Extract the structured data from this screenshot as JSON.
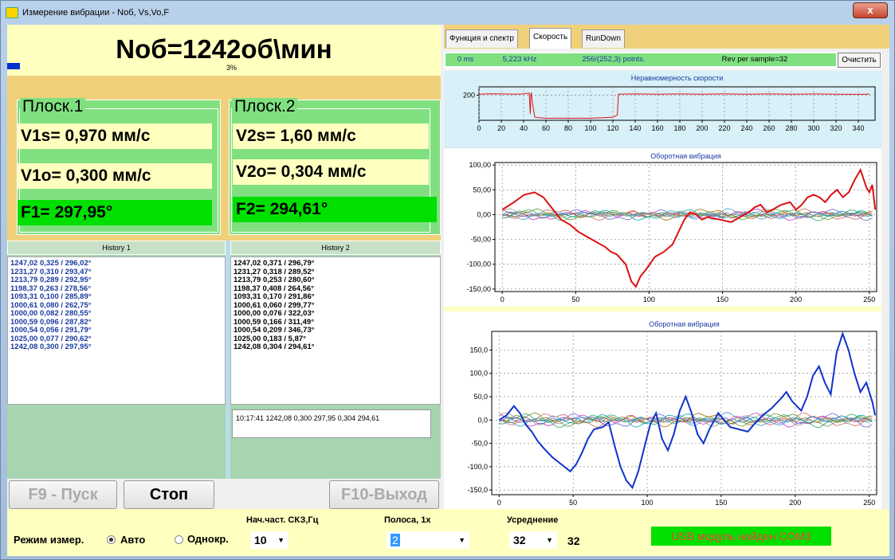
{
  "window": {
    "title": "Измерение вибрации - Nоб, Vs,Vo,F",
    "close_label": "x"
  },
  "speed": {
    "text": "Nоб=1242об\\мин",
    "progress_label": "3%",
    "progress_fraction": 0.03
  },
  "plane1": {
    "title": "Плоск.1",
    "vs": "V1s= 0,970 мм/с",
    "vo": "V1o= 0,300 мм/с",
    "f": "F1= 297,95°"
  },
  "plane2": {
    "title": "Плоск.2",
    "vs": "V2s= 1,60 мм/с",
    "vo": "V2o= 0,304 мм/с",
    "f": "F2= 294,61°"
  },
  "history1": {
    "title": "History 1",
    "rows": [
      "1247,02 0,325 / 296,02°",
      "1231,27 0,310 / 293,47°",
      "1213,79 0,289 / 292,95°",
      "1198,37 0,263 / 278,56°",
      "1093,31 0,100 / 285,89°",
      "1000,61 0,080 / 262,75°",
      "1000,00 0,082 / 280,55°",
      "1000,59 0,096 / 287,82°",
      "1000,54 0,056 / 291,79°",
      "1025,00 0,077 / 290,62°",
      "1242,08 0,300 / 297,95°"
    ]
  },
  "history2": {
    "title": "History 2",
    "rows": [
      "1247,02 0,371 / 296,79°",
      "1231,27 0,318 / 289,52°",
      "1213,79 0,253 / 280,60°",
      "1198,37 0,408 / 264,56°",
      "1093,31 0,170 / 291,86°",
      "1000,61 0,060 / 299,77°",
      "1000,00 0,076 / 322,03°",
      "1000,59 0,166 / 311,49°",
      "1000,54 0,209 / 346,73°",
      "1025,00 0,183 / 5,87°",
      "1242,08 0,304 / 294,61°"
    ]
  },
  "log": {
    "text": "10:17:41 1242,08 0,300 297,95 0,304 294,61"
  },
  "buttons": {
    "start": "F9 - Пуск",
    "stop": "Стоп",
    "exit": "F10-Выход"
  },
  "tabs": [
    "Функция и спектр",
    "Скорость",
    "RunDown"
  ],
  "active_tab": 1,
  "status": {
    "ms": "0 ms",
    "freq": "5,223 kHz",
    "points": "256/(252,3) points.",
    "rev": "Rev per sample=32",
    "clear": "Очистить"
  },
  "colors": {
    "panel_green": "#80e080",
    "value_yellow": "#ffffc0",
    "phase_green": "#00e000",
    "accent_red": "#dd1111",
    "accent_blue": "#1133cc"
  },
  "chart_data": [
    {
      "type": "line",
      "title": "Неравномерность скорости",
      "x_ticks": [
        "0",
        "20",
        "40",
        "60",
        "80",
        "100",
        "120",
        "140",
        "160",
        "180",
        "200",
        "220",
        "240",
        "260",
        "280",
        "300",
        "320",
        "340"
      ],
      "y_ticks": [
        "200"
      ],
      "xlim": [
        0,
        355
      ],
      "ylim": [
        80,
        240
      ],
      "grid": true,
      "series": [
        {
          "color": "#dd1111",
          "points": [
            [
              0,
              205
            ],
            [
              10,
              207
            ],
            [
              20,
              206
            ],
            [
              30,
              205
            ],
            [
              40,
              206
            ],
            [
              45,
              210
            ],
            [
              46,
              110
            ],
            [
              46.5,
              205
            ],
            [
              47,
              210
            ],
            [
              48,
              160
            ],
            [
              50,
              95
            ],
            [
              55,
              92
            ],
            [
              60,
              90
            ],
            [
              70,
              90
            ],
            [
              80,
              90
            ],
            [
              90,
              90
            ],
            [
              100,
              90
            ],
            [
              110,
              92
            ],
            [
              120,
              95
            ],
            [
              124,
              105
            ],
            [
              125,
              205
            ],
            [
              140,
              206
            ],
            [
              160,
              205
            ],
            [
              180,
              206
            ],
            [
              200,
              205
            ],
            [
              220,
              206
            ],
            [
              240,
              205
            ],
            [
              260,
              206
            ],
            [
              280,
              205
            ],
            [
              300,
              206
            ],
            [
              320,
              205
            ],
            [
              340,
              204
            ],
            [
              350,
              205
            ]
          ]
        }
      ]
    },
    {
      "type": "line",
      "title": "Оборотная вибрация",
      "x_ticks": [
        "0",
        "50",
        "100",
        "150",
        "200",
        "250"
      ],
      "y_ticks": [
        "100,00",
        "50,00",
        "0,00",
        "-50,00",
        "-100,00",
        "-150,00"
      ],
      "xlim": [
        -5,
        255
      ],
      "ylim": [
        -155,
        105
      ],
      "grid": true,
      "series": [
        {
          "color": "#dd1111",
          "points": [
            [
              0,
              10
            ],
            [
              8,
              25
            ],
            [
              15,
              40
            ],
            [
              22,
              45
            ],
            [
              28,
              35
            ],
            [
              32,
              20
            ],
            [
              36,
              5
            ],
            [
              40,
              -10
            ],
            [
              46,
              -20
            ],
            [
              52,
              -35
            ],
            [
              58,
              -45
            ],
            [
              64,
              -55
            ],
            [
              70,
              -65
            ],
            [
              74,
              -75
            ],
            [
              78,
              -80
            ],
            [
              84,
              -100
            ],
            [
              88,
              -135
            ],
            [
              91,
              -145
            ],
            [
              94,
              -125
            ],
            [
              98,
              -110
            ],
            [
              104,
              -85
            ],
            [
              110,
              -75
            ],
            [
              116,
              -60
            ],
            [
              120,
              -35
            ],
            [
              124,
              -10
            ],
            [
              128,
              5
            ],
            [
              132,
              0
            ],
            [
              136,
              -10
            ],
            [
              140,
              -5
            ],
            [
              148,
              -10
            ],
            [
              156,
              -15
            ],
            [
              162,
              -5
            ],
            [
              168,
              5
            ],
            [
              172,
              15
            ],
            [
              176,
              20
            ],
            [
              180,
              5
            ],
            [
              184,
              10
            ],
            [
              190,
              20
            ],
            [
              196,
              25
            ],
            [
              200,
              10
            ],
            [
              204,
              20
            ],
            [
              208,
              35
            ],
            [
              212,
              40
            ],
            [
              216,
              35
            ],
            [
              220,
              25
            ],
            [
              224,
              40
            ],
            [
              228,
              50
            ],
            [
              232,
              35
            ],
            [
              236,
              45
            ],
            [
              240,
              70
            ],
            [
              244,
              90
            ],
            [
              248,
              55
            ],
            [
              250,
              45
            ],
            [
              252,
              60
            ],
            [
              254,
              10
            ]
          ]
        }
      ]
    },
    {
      "type": "line",
      "title": "Оборотная вибрация",
      "x_ticks": [
        "0",
        "50",
        "100",
        "150",
        "200",
        "250"
      ],
      "y_ticks": [
        "150,0",
        "100,0",
        "50,0",
        "0,0",
        "-50,0",
        "-100,0",
        "-150,0"
      ],
      "xlim": [
        -5,
        255
      ],
      "ylim": [
        -160,
        190
      ],
      "grid": true,
      "series": [
        {
          "color": "#1133cc",
          "points": [
            [
              0,
              0
            ],
            [
              5,
              10
            ],
            [
              10,
              30
            ],
            [
              14,
              15
            ],
            [
              18,
              -10
            ],
            [
              22,
              -25
            ],
            [
              26,
              -45
            ],
            [
              30,
              -60
            ],
            [
              36,
              -80
            ],
            [
              42,
              -95
            ],
            [
              48,
              -110
            ],
            [
              52,
              -95
            ],
            [
              56,
              -70
            ],
            [
              60,
              -40
            ],
            [
              64,
              -20
            ],
            [
              70,
              -15
            ],
            [
              74,
              -5
            ],
            [
              78,
              -55
            ],
            [
              82,
              -100
            ],
            [
              86,
              -130
            ],
            [
              90,
              -145
            ],
            [
              94,
              -110
            ],
            [
              98,
              -60
            ],
            [
              102,
              -10
            ],
            [
              106,
              15
            ],
            [
              110,
              -40
            ],
            [
              114,
              -65
            ],
            [
              118,
              -30
            ],
            [
              122,
              20
            ],
            [
              126,
              50
            ],
            [
              130,
              15
            ],
            [
              134,
              -30
            ],
            [
              138,
              -50
            ],
            [
              142,
              -20
            ],
            [
              148,
              15
            ],
            [
              152,
              0
            ],
            [
              156,
              -15
            ],
            [
              162,
              -20
            ],
            [
              168,
              -25
            ],
            [
              172,
              -10
            ],
            [
              178,
              10
            ],
            [
              184,
              25
            ],
            [
              190,
              45
            ],
            [
              194,
              60
            ],
            [
              198,
              40
            ],
            [
              204,
              20
            ],
            [
              208,
              50
            ],
            [
              212,
              95
            ],
            [
              216,
              115
            ],
            [
              220,
              80
            ],
            [
              224,
              55
            ],
            [
              228,
              145
            ],
            [
              232,
              185
            ],
            [
              236,
              150
            ],
            [
              240,
              100
            ],
            [
              244,
              60
            ],
            [
              248,
              80
            ],
            [
              252,
              40
            ],
            [
              254,
              10
            ]
          ]
        }
      ]
    }
  ],
  "bottom": {
    "mode_label": "Режим измер.",
    "auto": "Авто",
    "single": "Однокр.",
    "freq_label": "Нач.част. СКЗ,Гц",
    "freq_value": "10",
    "band_label": "Полоса, 1х",
    "band_value": "2",
    "avg_label": "Усреднение",
    "avg_value": "32",
    "avg_readout": "32",
    "usb_status": "USB модуль найден COM3"
  }
}
